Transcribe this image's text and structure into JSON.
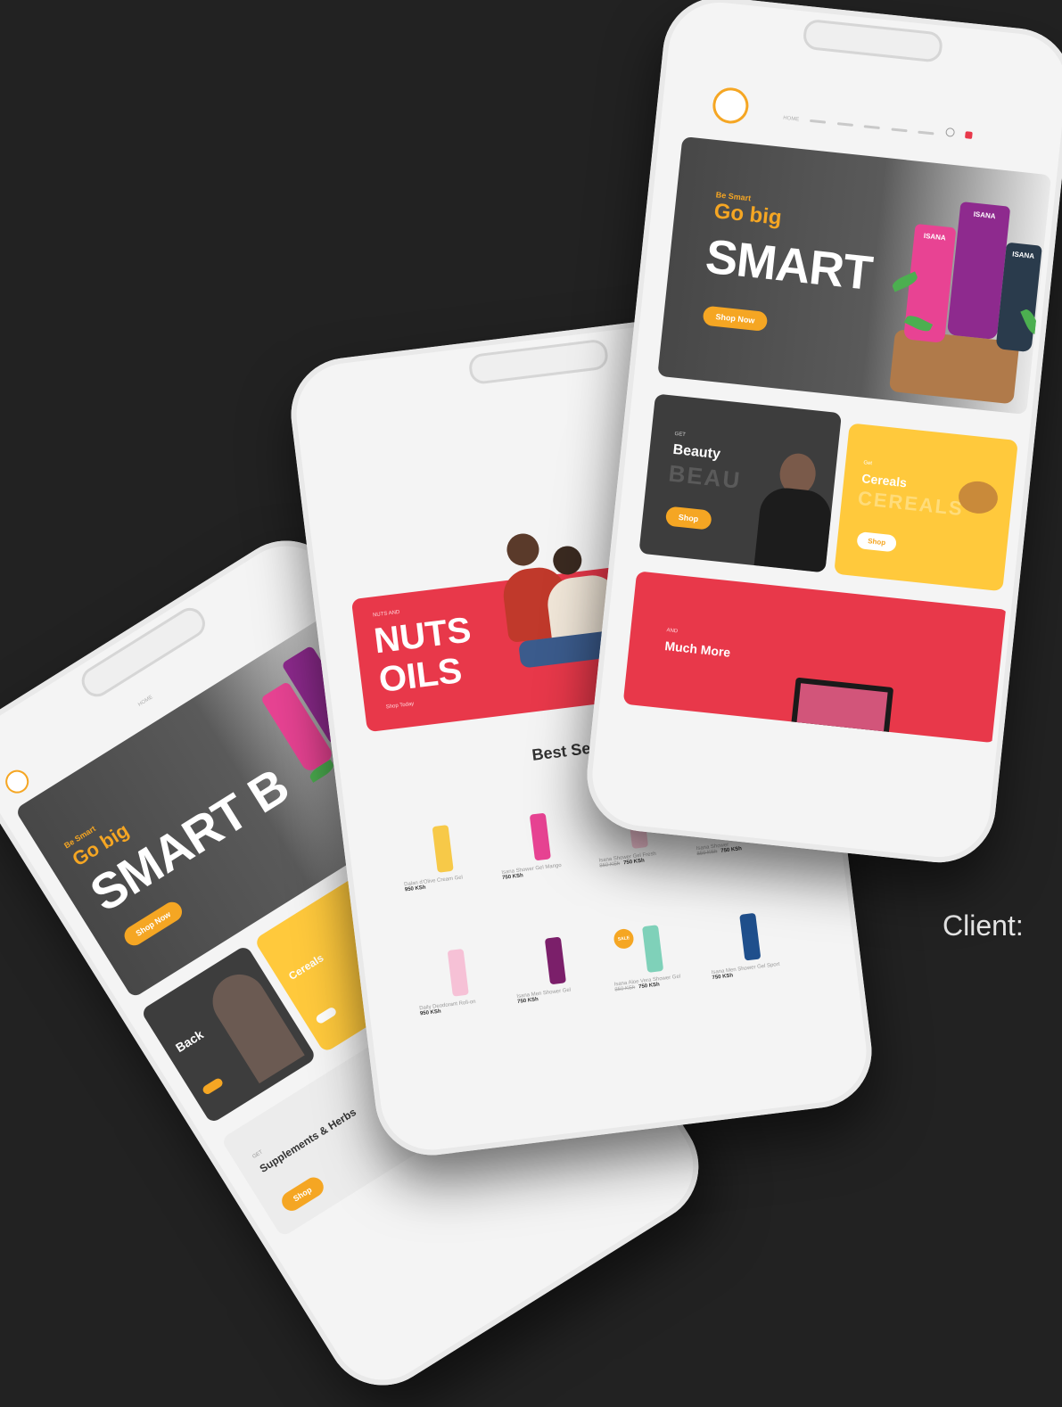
{
  "client_label": "Client:",
  "colors": {
    "background": "#222222",
    "accent": "#f5a623",
    "red": "#e8384a",
    "yellow": "#ffc93c",
    "dark": "#474747"
  },
  "phone_front": {
    "nav_label": "HOME",
    "hero": {
      "eyebrow": "Be Smart",
      "headline": "Go big",
      "big_word": "SMART",
      "button": "Shop Now",
      "bottles": [
        "ISANA",
        "ISANA",
        "ISANA"
      ]
    },
    "beauty": {
      "eyebrow": "GET",
      "title": "Beauty",
      "ghost": "BEAU",
      "button": "Shop"
    },
    "cereals": {
      "eyebrow": "Get",
      "title": "Cereals",
      "ghost": "CEREALS",
      "button": "Shop"
    },
    "more": {
      "eyebrow": "AND",
      "title": "Much More"
    }
  },
  "phone_middle": {
    "promo": {
      "eyebrow": "NUTS AND",
      "line1": "NUTS",
      "line2": "OILS",
      "tag": "Shop Today"
    },
    "section_title": "Best Seller Pr",
    "products": [
      {
        "name": "Dalan d'Olive Cream Gel",
        "price": "950 KSh"
      },
      {
        "name": "Isana Shower Gel Mango",
        "price": "750 KSh"
      },
      {
        "name": "Isana Shower Gel Fresh",
        "old_price": "850 KSh",
        "price": "750 KSh"
      },
      {
        "name": "Isana Shower",
        "old_price": "850 KSh",
        "price": "750 KSh"
      },
      {
        "name": "Daily Deodorant Roll-on",
        "price": "950 KSh"
      },
      {
        "name": "Isana Men Shower Gel",
        "price": "750 KSh"
      },
      {
        "name": "Isana Aloe Vera Shower Gel",
        "old_price": "850 KSh",
        "price": "750 KSh"
      },
      {
        "name": "Isana Men Shower Gel Sport",
        "price": "750 KSh"
      }
    ],
    "sale_badge": "SALE"
  },
  "phone_back": {
    "nav_label": "HOME",
    "hero": {
      "eyebrow": "Be Smart",
      "headline": "Go big",
      "big_word": "SMART B",
      "button": "Shop Now"
    },
    "beauty_title": "Back",
    "cereals_title": "Cereals",
    "supplements": {
      "eyebrow": "GET",
      "title": "Supplements & Herbs",
      "button": "Shop"
    }
  }
}
